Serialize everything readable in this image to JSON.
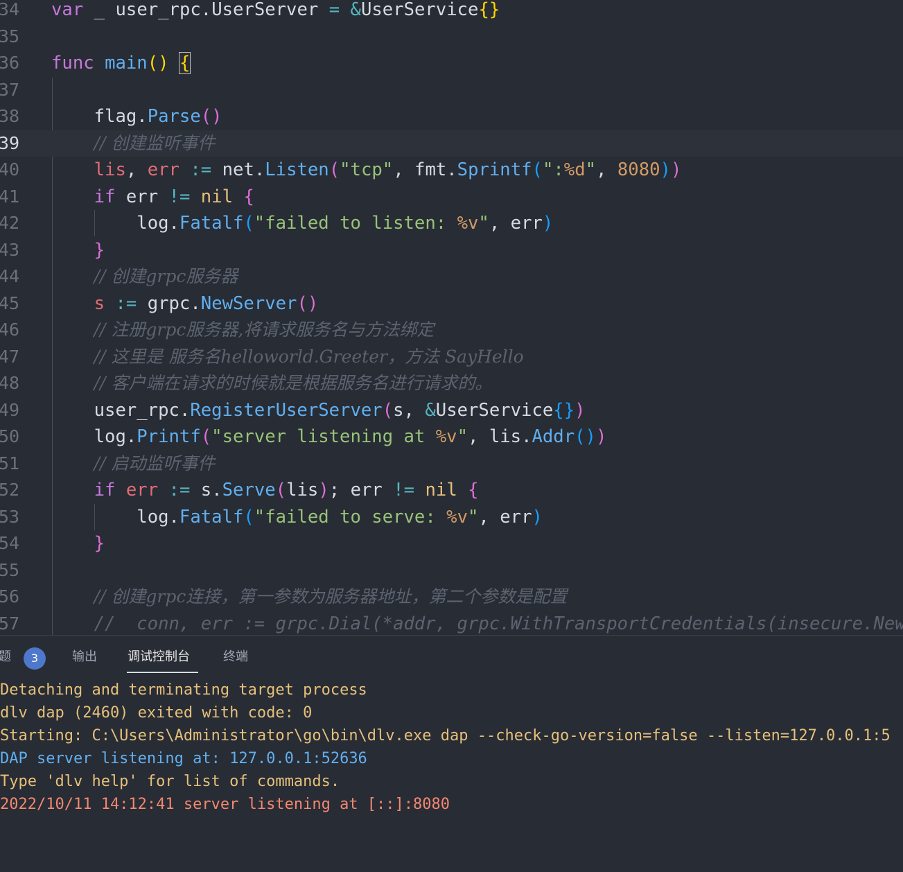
{
  "editor": {
    "current_line": "39",
    "lines": [
      {
        "n": "34",
        "code": "var _ user_rpc.UserServer = &UserService{}"
      },
      {
        "n": "35",
        "code": ""
      },
      {
        "n": "36",
        "code": "func main() {"
      },
      {
        "n": "37",
        "code": ""
      },
      {
        "n": "38",
        "code": "    flag.Parse()"
      },
      {
        "n": "39",
        "code": "    // 创建监听事件"
      },
      {
        "n": "40",
        "code": "    lis, err := net.Listen(\"tcp\", fmt.Sprintf(\":%d\", 8080))"
      },
      {
        "n": "41",
        "code": "    if err != nil {"
      },
      {
        "n": "42",
        "code": "        log.Fatalf(\"failed to listen: %v\", err)"
      },
      {
        "n": "43",
        "code": "    }"
      },
      {
        "n": "44",
        "code": "    // 创建grpc服务器"
      },
      {
        "n": "45",
        "code": "    s := grpc.NewServer()"
      },
      {
        "n": "46",
        "code": "    // 注册grpc服务器,将请求服务名与方法绑定"
      },
      {
        "n": "47",
        "code": "    // 这里是 服务名helloworld.Greeter，方法 SayHello"
      },
      {
        "n": "48",
        "code": "    // 客户端在请求的时候就是根据服务名进行请求的。"
      },
      {
        "n": "49",
        "code": "    user_rpc.RegisterUserServer(s, &UserService{})"
      },
      {
        "n": "50",
        "code": "    log.Printf(\"server listening at %v\", lis.Addr())"
      },
      {
        "n": "51",
        "code": "    // 启动监听事件"
      },
      {
        "n": "52",
        "code": "    if err := s.Serve(lis); err != nil {"
      },
      {
        "n": "53",
        "code": "        log.Fatalf(\"failed to serve: %v\", err)"
      },
      {
        "n": "54",
        "code": "    }"
      },
      {
        "n": "55",
        "code": ""
      },
      {
        "n": "56",
        "code": "    // 创建grpc连接，第一参数为服务器地址，第二个参数是配置"
      },
      {
        "n": "57",
        "code": "    //  conn, err := grpc.Dial(*addr, grpc.WithTransportCredentials(insecure.New"
      }
    ]
  },
  "panel": {
    "tabs": [
      {
        "label": "题",
        "badge": "3"
      },
      {
        "label": "输出"
      },
      {
        "label": "调试控制台",
        "active": true
      },
      {
        "label": "终端"
      }
    ],
    "output_lines": [
      {
        "text": "Detaching and terminating target process",
        "color": "#e5c07b"
      },
      {
        "text": "dlv dap (2460) exited with code: 0",
        "color": "#e5c07b"
      },
      {
        "text": "Starting: C:\\Users\\Administrator\\go\\bin\\dlv.exe dap --check-go-version=false --listen=127.0.0.1:5",
        "color": "#e5c07b"
      },
      {
        "text": "DAP server listening at: 127.0.0.1:52636",
        "color": "#61afef"
      },
      {
        "text": "Type 'dlv help' for list of commands.",
        "color": "#e5c07b"
      },
      {
        "text": "2022/10/11 14:12:41 server listening at [::]:8080",
        "color": "#f48771"
      }
    ]
  },
  "colors": {
    "background": "#282c34",
    "current_line": "#2c313a",
    "badge": "#4d78cc"
  }
}
